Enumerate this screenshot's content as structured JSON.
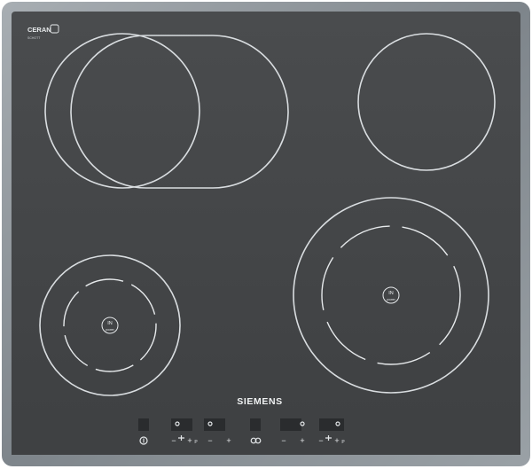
{
  "hob": {
    "ceran_logo": "CERAN",
    "ceran_subtext": "SCHOTT",
    "brand": "SIEMENS",
    "colors": {
      "frame": "#8b9197",
      "glass": "#454749",
      "ring": "#d9dde0"
    },
    "zones": [
      {
        "name": "extended-oval-zone"
      },
      {
        "name": "rear-right-zone"
      },
      {
        "name": "front-left-zone",
        "badge_top": "IN",
        "badge_bottom": "power"
      },
      {
        "name": "front-right-zone",
        "badge_top": "IN",
        "badge_bottom": "power"
      }
    ],
    "controls": {
      "minus_label": "−",
      "plus_label": "+",
      "p_label": "P"
    }
  }
}
